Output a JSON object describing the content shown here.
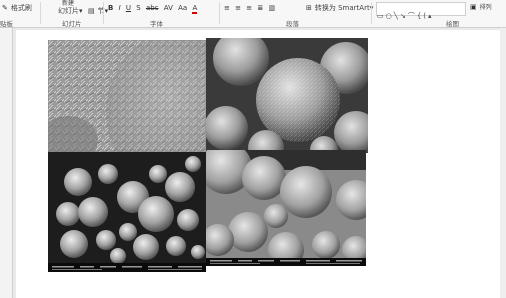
{
  "ribbon": {
    "clipboard": {
      "format_painter": "格式刷",
      "group_label": "贴板"
    },
    "slides": {
      "new_slide_top": "新建",
      "new_slide": "幻灯片",
      "section": "节",
      "group_label": "幻灯片"
    },
    "font": {
      "bold": "B",
      "italic": "I",
      "underline": "U",
      "shadow": "S",
      "strike": "abc",
      "spacing": "AV",
      "case": "Aa",
      "color": "A",
      "group_label": "字体"
    },
    "paragraph": {
      "smartart": "转换为 SmartArt",
      "group_label": "段落"
    },
    "drawing": {
      "arrange": "排列",
      "group_label": "绘图"
    }
  },
  "icons": {
    "format_painter": "paintbrush-icon",
    "new_slide": "new-slide-icon",
    "section": "section-icon",
    "align_left": "align-left-icon",
    "align_center": "align-center-icon",
    "align_right": "align-right-icon",
    "justify": "justify-icon",
    "columns": "columns-icon",
    "smartart": "smartart-icon",
    "shapes": "shapes-gallery-icon"
  },
  "colors": {
    "ribbon_bg": "#f7f7f7",
    "workspace_bg": "#e9e9e9",
    "slide_bg": "#ffffff",
    "sem_gray": "#8c8c8c"
  }
}
